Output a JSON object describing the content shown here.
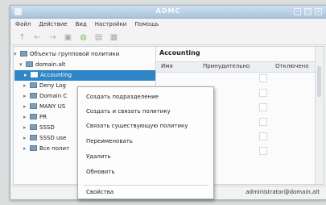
{
  "window": {
    "title": "ADMC"
  },
  "menubar": [
    "Файл",
    "Действие",
    "Вид",
    "Настройки",
    "Помощь"
  ],
  "toolbar": {
    "buttons": [
      "arrow-up-icon",
      "arrow-left-icon",
      "arrow-right-icon",
      "document-icon",
      "group-icon",
      "computer-icon",
      "table-icon"
    ]
  },
  "tree": {
    "items": [
      {
        "label": "Объекты групповой политики",
        "expanded": true
      },
      {
        "label": "domain.alt",
        "expanded": true
      },
      {
        "label": "Accounting",
        "selected": true
      },
      {
        "label": "Deny Log"
      },
      {
        "label": "Domain C"
      },
      {
        "label": "MANY US"
      },
      {
        "label": "PR"
      },
      {
        "label": "SSSD"
      },
      {
        "label": "SSSD use"
      },
      {
        "label": "Все полит"
      }
    ]
  },
  "right_pane": {
    "title": "Accounting",
    "columns": [
      "Имя",
      "Принудительно",
      "Отключено"
    ]
  },
  "context_menu": {
    "items": [
      "Создать подразделение",
      "Создать и связать политику",
      "Связать существующую политику",
      "Переименовать",
      "Удалить",
      "Обновить",
      "Свойства"
    ]
  },
  "statusbar": {
    "text": "administrator@domain.alt"
  }
}
